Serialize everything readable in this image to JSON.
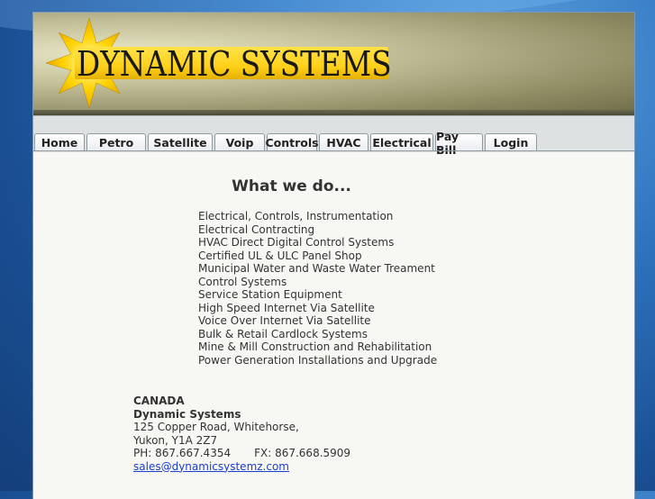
{
  "brand": {
    "logo_text": "DYNAMIC SYSTEMS"
  },
  "nav": {
    "tabs": [
      {
        "label": "Home"
      },
      {
        "label": "Petro"
      },
      {
        "label": "Satellite"
      },
      {
        "label": "Voip"
      },
      {
        "label": "Controls"
      },
      {
        "label": "HVAC"
      },
      {
        "label": "Electrical"
      },
      {
        "label": "Pay Bill"
      },
      {
        "label": "Login"
      }
    ]
  },
  "main": {
    "heading": "What we do...",
    "services": [
      "Electrical, Controls, Instrumentation",
      "Electrical Contracting",
      "HVAC Direct Digital Control Systems",
      "Certified UL & ULC Panel Shop",
      "Municipal Water and Waste Water Treament Control Systems",
      "Service Station Equipment",
      "High Speed Internet Via Satellite",
      "Voice Over Internet Via Satellite",
      "Bulk & Retail Cardlock Systems",
      "Mine & Mill Construction and Rehabilitation",
      "Power Generation Installations and Upgrade"
    ]
  },
  "contact": {
    "country": "CANADA",
    "company": "Dynamic Systems",
    "street": "125 Copper Road, Whitehorse,",
    "city": "Yukon, Y1A 2Z7",
    "phone": "PH: 867.667.4354",
    "fax": "FX: 867.668.5909",
    "email": "sales@dynamicsystemz.com"
  },
  "colors": {
    "desktop_blue": "#2f75c0",
    "logo_yellow": "#ffd11a",
    "link_blue": "#1a3fd0"
  }
}
